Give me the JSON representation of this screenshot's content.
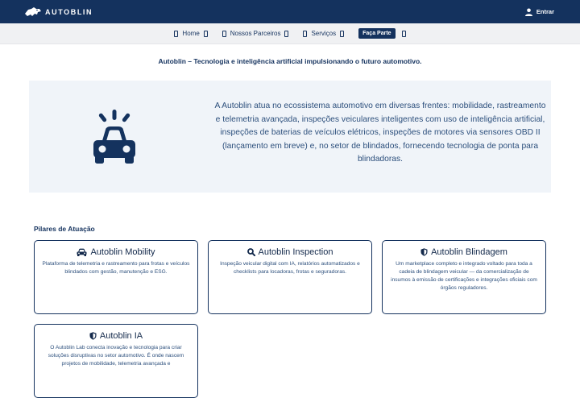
{
  "header": {
    "brand": "AUTOBLIN",
    "login_label": "Entrar"
  },
  "nav": {
    "items": [
      {
        "label": "Home"
      },
      {
        "label": "Nossos Parceiros"
      },
      {
        "label": "Serviços"
      }
    ],
    "cta_label": "Faça Parte"
  },
  "tagline": "Autoblin – Tecnologia e inteligência artificial impulsionando o futuro automotivo.",
  "hero": {
    "icon": "car-alert-icon",
    "text": "A Autoblin atua no ecossistema automotivo em diversas frentes: mobilidade, rastreamento e telemetria avançada, inspeções veiculares inteligentes com uso de inteligência artificial, inspeções de baterias de veículos elétricos, inspeções de motores via sensores OBD II (lançamento em breve) e, no setor de blindados, fornecendo tecnologia de ponta para blindadoras."
  },
  "pillars": {
    "title": "Pilares de Atuação",
    "cards": [
      {
        "icon": "car-icon",
        "title": "Autoblin Mobility",
        "description": "Plataforma de telemetria e rastreamento para frotas e veículos blindados com gestão, manutenção e ESG."
      },
      {
        "icon": "search-icon",
        "title": "Autoblin Inspection",
        "description": "Inspeção veicular digital com IA, relatórios automatizados e checklists para locadoras, frotas e seguradoras."
      },
      {
        "icon": "shield-icon",
        "title": "Autoblin Blindagem",
        "description": "Um marketplace completo e integrado voltado para toda a cadeia de blindagem veicular — da comercialização de insumos à emissão de certificações e integrações oficiais com órgãos reguladores."
      },
      {
        "icon": "shield-icon",
        "title": "Autoblin IA",
        "description": "O Autoblin Lab conecta inovação e tecnologia para criar soluções disruptivas no setor automotivo. É onde nascem projetos de mobilidade, telemetria avançada e"
      }
    ]
  },
  "colors": {
    "primary": "#14325e",
    "hero_bg": "#f0f4f9",
    "text_body": "#2c4f7c"
  }
}
